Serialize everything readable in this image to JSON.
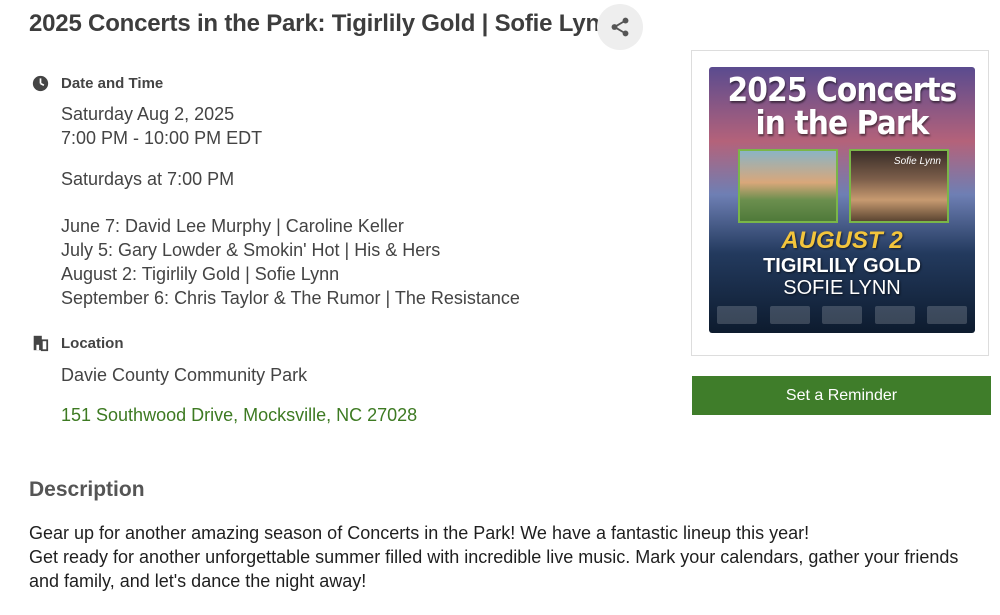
{
  "event": {
    "title": "2025 Concerts in the Park: Tigirlily Gold | Sofie Lynn"
  },
  "date_time": {
    "heading": "Date and Time",
    "date": "Saturday Aug 2, 2025",
    "time": "7:00 PM - 10:00 PM EDT",
    "recurrence": "Saturdays at 7:00 PM",
    "schedule": [
      "June 7: David Lee Murphy | Caroline Keller",
      "July 5: Gary Lowder & Smokin' Hot | His & Hers",
      "August 2: Tigirlily Gold | Sofie Lynn",
      "September 6: Chris Taylor & The Rumor | The Resistance"
    ]
  },
  "location": {
    "heading": "Location",
    "venue": "Davie County Community Park",
    "address": "151 Southwood Drive, Mocksville, NC 27028"
  },
  "description": {
    "heading": "Description",
    "line1": "Gear up for another amazing season of Concerts in the Park! We have a fantastic lineup this year!",
    "line2": "Get ready for another unforgettable summer filled with incredible live music. Mark your calendars, gather your friends and family, and let's dance the night away!"
  },
  "poster": {
    "title": "2025 Concerts in the Park",
    "photo_caption": "Sofie Lynn",
    "date": "AUGUST 2",
    "act1": "TIGIRLILY GOLD",
    "act2": "SOFIE LYNN"
  },
  "actions": {
    "reminder_label": "Set a Reminder"
  },
  "icons": {
    "share": "share-icon",
    "clock": "clock-icon",
    "location": "building-icon"
  },
  "colors": {
    "accent_green": "#3f7d2a",
    "link_green": "#3d7a22"
  }
}
